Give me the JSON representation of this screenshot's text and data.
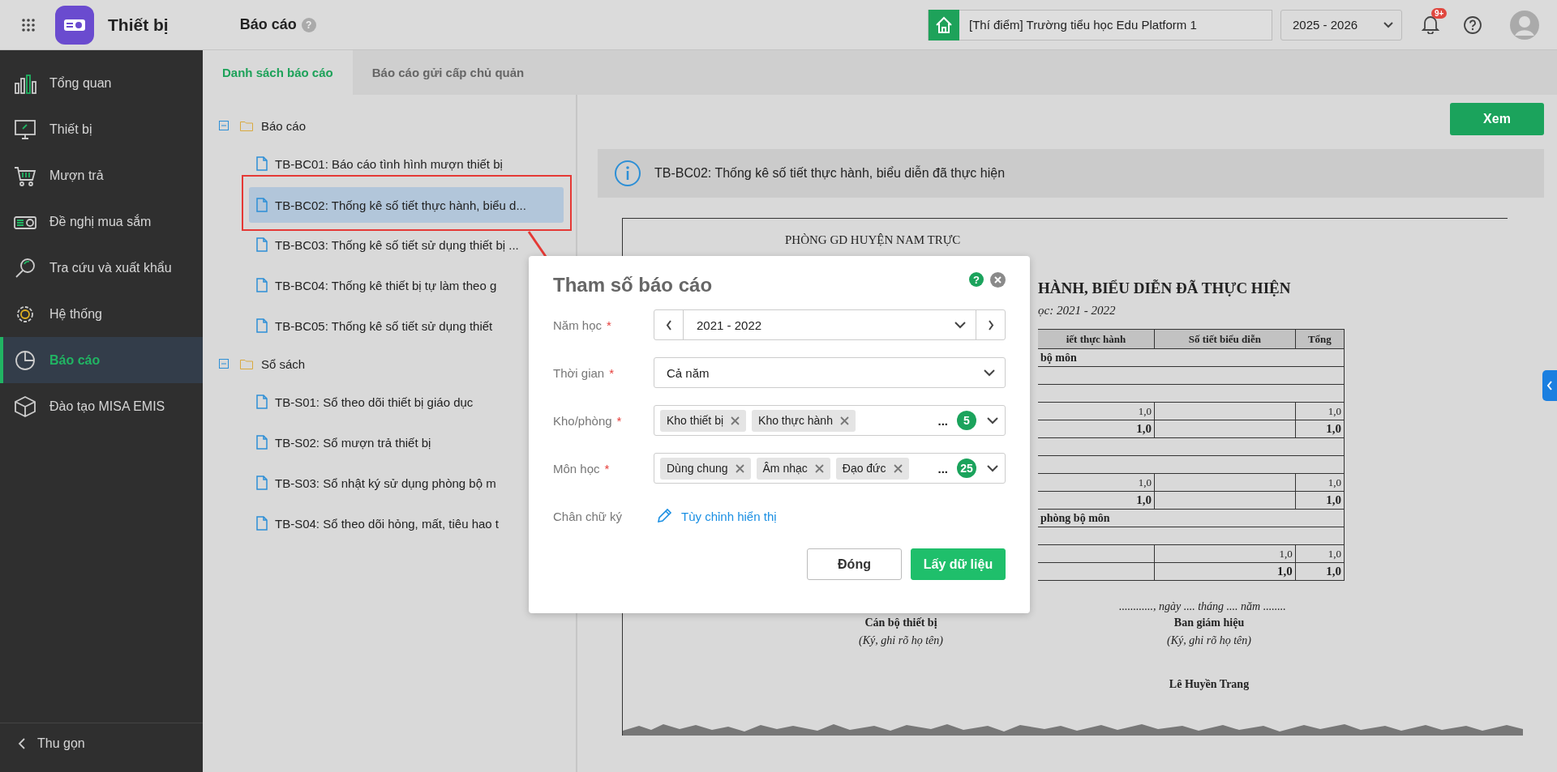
{
  "app": {
    "name": "Thiết bị"
  },
  "header": {
    "page_title": "Báo cáo",
    "help": "?",
    "school": "[Thí điểm] Trường tiểu học Edu Platform 1",
    "year": "2025 - 2026",
    "notification_badge": "9+"
  },
  "sidebar": {
    "items": [
      {
        "label": "Tổng quan",
        "kind": "chart",
        "selected": false
      },
      {
        "label": "Thiết bị",
        "kind": "monitor",
        "selected": false
      },
      {
        "label": "Mượn trả",
        "kind": "cart",
        "selected": false
      },
      {
        "label": "Đề nghị mua sắm",
        "kind": "projector",
        "selected": false
      },
      {
        "label": "Tra cứu và xuất khẩu",
        "kind": "search",
        "selected": false
      },
      {
        "label": "Hệ thống",
        "kind": "gear",
        "selected": false
      },
      {
        "label": "Báo cáo",
        "kind": "pie",
        "selected": true
      },
      {
        "label": "Đào tạo MISA EMIS",
        "kind": "cube",
        "selected": false
      }
    ],
    "collapse": "Thu gọn"
  },
  "tabs": [
    {
      "label": "Danh sách báo cáo",
      "selected": true
    },
    {
      "label": "Báo cáo gửi cấp chủ quản",
      "selected": false
    }
  ],
  "tree": [
    {
      "label": "Báo cáo",
      "expanded": true,
      "children": [
        {
          "label": "TB-BC01: Báo cáo tình hình mượn thiết bị",
          "selected": false
        },
        {
          "label": "TB-BC02: Thống kê số tiết thực hành, biểu d...",
          "selected": true
        },
        {
          "label": "TB-BC03: Thống kê số tiết sử dụng thiết bị ...",
          "selected": false
        },
        {
          "label": "TB-BC04: Thống kê thiết bị tự làm theo g",
          "selected": false
        },
        {
          "label": "TB-BC05: Thống kê số tiết sử dụng thiết",
          "selected": false
        }
      ]
    },
    {
      "label": "Sổ sách",
      "expanded": true,
      "children": [
        {
          "label": "TB-S01: Sổ theo dõi thiết bị giáo dục",
          "selected": false
        },
        {
          "label": "TB-S02: Sổ mượn trả thiết bị",
          "selected": false
        },
        {
          "label": "TB-S03: Sổ nhật ký sử dụng phòng bộ m",
          "selected": false
        },
        {
          "label": "TB-S04: Sổ theo dõi hỏng, mất, tiêu hao t",
          "selected": false
        }
      ]
    }
  ],
  "view_button": "Xem",
  "info_bar": "TB-BC02: Thống kê số tiết thực hành, biểu diễn đã thực hiện",
  "report": {
    "department": "PHÒNG GD HUYỆN NAM TRỰC",
    "title": "HÀNH, BIỂU DIỄN ĐÃ THỰC HIỆN",
    "year_line": "ọc: 2021 - 2022",
    "table": {
      "columns": [
        "iết thực hành",
        "Số tiết biểu diễn",
        "Tổng"
      ],
      "rows": [
        {
          "kind": "group",
          "text": "bộ môn"
        },
        {
          "kind": "blank"
        },
        {
          "kind": "blank"
        },
        {
          "kind": "data",
          "cells": [
            "1,0",
            "",
            "1,0"
          ]
        },
        {
          "kind": "total",
          "cells": [
            "1,0",
            "",
            "1,0"
          ]
        },
        {
          "kind": "blank"
        },
        {
          "kind": "blank"
        },
        {
          "kind": "data",
          "cells": [
            "1,0",
            "",
            "1,0"
          ]
        },
        {
          "kind": "total",
          "cells": [
            "1,0",
            "",
            "1,0"
          ]
        },
        {
          "kind": "group",
          "text": "phòng bộ môn"
        },
        {
          "kind": "blank"
        },
        {
          "kind": "data",
          "cells": [
            "",
            "1,0",
            "1,0"
          ]
        },
        {
          "kind": "total",
          "cells": [
            "",
            "1,0",
            "1,0"
          ]
        }
      ]
    },
    "date_line": "............, ngày .... tháng .... năm ........",
    "signers": [
      {
        "role": "Cán bộ thiết bị",
        "note": "(Ký, ghi rõ họ tên)"
      },
      {
        "role": "Ban giám hiệu",
        "note": "(Ký, ghi rõ họ tên)",
        "name": "Lê Huyền Trang"
      }
    ]
  },
  "dialog": {
    "title": "Tham số báo cáo",
    "help": "?",
    "fields": [
      {
        "kind": "stepper",
        "label": "Năm học",
        "mark": "*",
        "value": "2021 - 2022"
      },
      {
        "kind": "select",
        "label": "Thời gian",
        "mark": "*",
        "value": "Cả năm"
      },
      {
        "kind": "tags",
        "label": "Kho/phòng",
        "mark": "*",
        "tags": [
          "Kho thiết bị",
          "Kho thực hành"
        ],
        "more": "...",
        "count": "5"
      },
      {
        "kind": "tags",
        "label": "Môn học",
        "mark": "*",
        "tags": [
          "Dùng chung",
          "Âm nhạc",
          "Đạo đức"
        ],
        "more": "...",
        "count": "25"
      },
      {
        "kind": "link",
        "label": "Chân chữ ký",
        "link": "Tùy chỉnh hiển thị"
      }
    ],
    "buttons": [
      {
        "label": "Đóng",
        "kind": "secondary"
      },
      {
        "label": "Lấy dữ liệu",
        "kind": "primary"
      }
    ]
  }
}
